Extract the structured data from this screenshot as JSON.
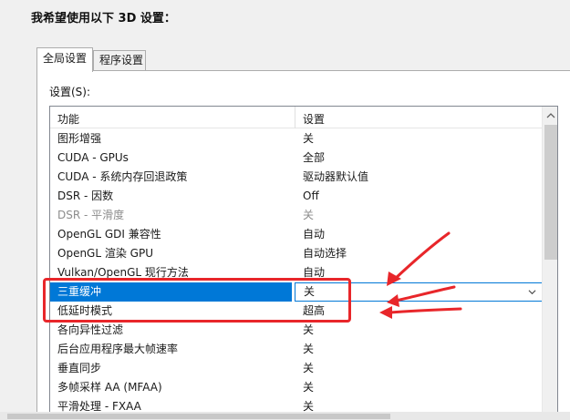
{
  "heading": "我希望使用以下 3D 设置：",
  "tabs": [
    {
      "label": "全局设置",
      "active": true
    },
    {
      "label": "程序设置",
      "active": false
    }
  ],
  "settings_label": "设置(S):",
  "list": {
    "col_feature": "功能",
    "col_setting": "设置",
    "rows": [
      {
        "feature": "图形增强",
        "value": "关"
      },
      {
        "feature": "CUDA - GPUs",
        "value": "全部"
      },
      {
        "feature": "CUDA - 系统内存回退政策",
        "value": "驱动器默认值"
      },
      {
        "feature": "DSR - 因数",
        "value": "Off"
      },
      {
        "feature": "DSR - 平滑度",
        "value": "关"
      },
      {
        "feature": "OpenGL GDI 兼容性",
        "value": "自动"
      },
      {
        "feature": "OpenGL 渲染 GPU",
        "value": "自动选择"
      },
      {
        "feature": "Vulkan/OpenGL 现行方法",
        "value": "自动"
      },
      {
        "feature": "三重缓冲",
        "value": "关"
      },
      {
        "feature": "低延时模式",
        "value": "超高"
      },
      {
        "feature": "各向异性过滤",
        "value": "关"
      },
      {
        "feature": "后台应用程序最大帧速率",
        "value": "关"
      },
      {
        "feature": "垂直同步",
        "value": "关"
      },
      {
        "feature": "多帧采样 AA (MFAA)",
        "value": "关"
      },
      {
        "feature": "平滑处理 - FXAA",
        "value": "关"
      }
    ]
  },
  "colors": {
    "selection": "#0078d7",
    "annotation": "#e8262a",
    "disabled_text": "#8c8c8c"
  }
}
